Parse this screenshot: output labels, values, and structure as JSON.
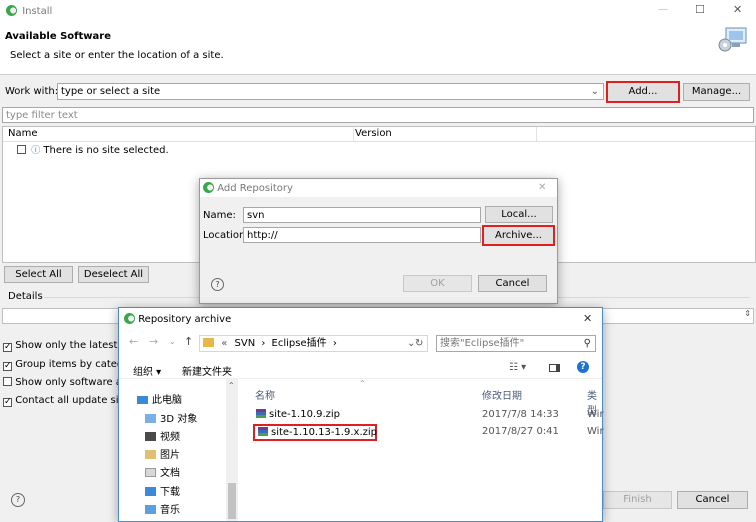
{
  "install": {
    "title": "Install",
    "section_title": "Available Software",
    "subtitle": "Select a site or enter the location of a site.",
    "work_with_label": "Work with:",
    "work_with_value": "type or select a site",
    "add_label": "Add...",
    "manage_label": "Manage...",
    "filter_placeholder": "type filter text",
    "table": {
      "columns": [
        "Name",
        "Version"
      ],
      "rows": [
        {
          "name": "There is no site selected."
        }
      ]
    },
    "select_all_label": "Select All",
    "deselect_all_label": "Deselect All",
    "details_label": "Details",
    "options": [
      {
        "label": "Show only the latest ve",
        "checked": true
      },
      {
        "label": "Group items by catego",
        "checked": true
      },
      {
        "label": "Show only software app",
        "checked": false
      },
      {
        "label": "Contact all update sites",
        "checked": true
      }
    ],
    "finish_label": "Finish",
    "cancel_label": "Cancel",
    "help_glyph": "?",
    "window_controls": {
      "minimize": "—",
      "maximize": "☐",
      "close": "✕"
    }
  },
  "add_repository": {
    "title": "Add Repository",
    "name_label": "Name:",
    "name_value": "svn",
    "location_label": "Location:",
    "location_value": "http://",
    "local_label": "Local...",
    "archive_label": "Archive...",
    "ok_label": "OK",
    "cancel_label": "Cancel",
    "help_glyph": "?",
    "close_glyph": "✕"
  },
  "repository_archive": {
    "title": "Repository archive",
    "close_glyph": "✕",
    "breadcrumb": {
      "prefix": "«",
      "parts": [
        "SVN",
        "Eclipse插件"
      ],
      "separator": "›"
    },
    "search_placeholder": "搜索\"Eclipse插件\"",
    "organize_label": "组织 ▾",
    "new_folder_label": "新建文件夹",
    "tree": [
      {
        "label": "此电脑",
        "icon": "computer-icon"
      },
      {
        "label": "3D 对象",
        "icon": "3d-objects-icon"
      },
      {
        "label": "视频",
        "icon": "video-folder-icon"
      },
      {
        "label": "图片",
        "icon": "pictures-folder-icon"
      },
      {
        "label": "文档",
        "icon": "documents-folder-icon"
      },
      {
        "label": "下载",
        "icon": "downloads-folder-icon"
      },
      {
        "label": "音乐",
        "icon": "music-folder-icon"
      }
    ],
    "columns": {
      "name": "名称",
      "date": "修改日期",
      "type": "类型"
    },
    "files": [
      {
        "name": "site-1.10.9.zip",
        "date": "2017/7/8 14:33",
        "type": "Wir"
      },
      {
        "name": "site-1.10.13-1.9.x.zip",
        "date": "2017/8/27 0:41",
        "type": "Wir"
      }
    ],
    "colors": {
      "highlight": "#e02020"
    }
  }
}
